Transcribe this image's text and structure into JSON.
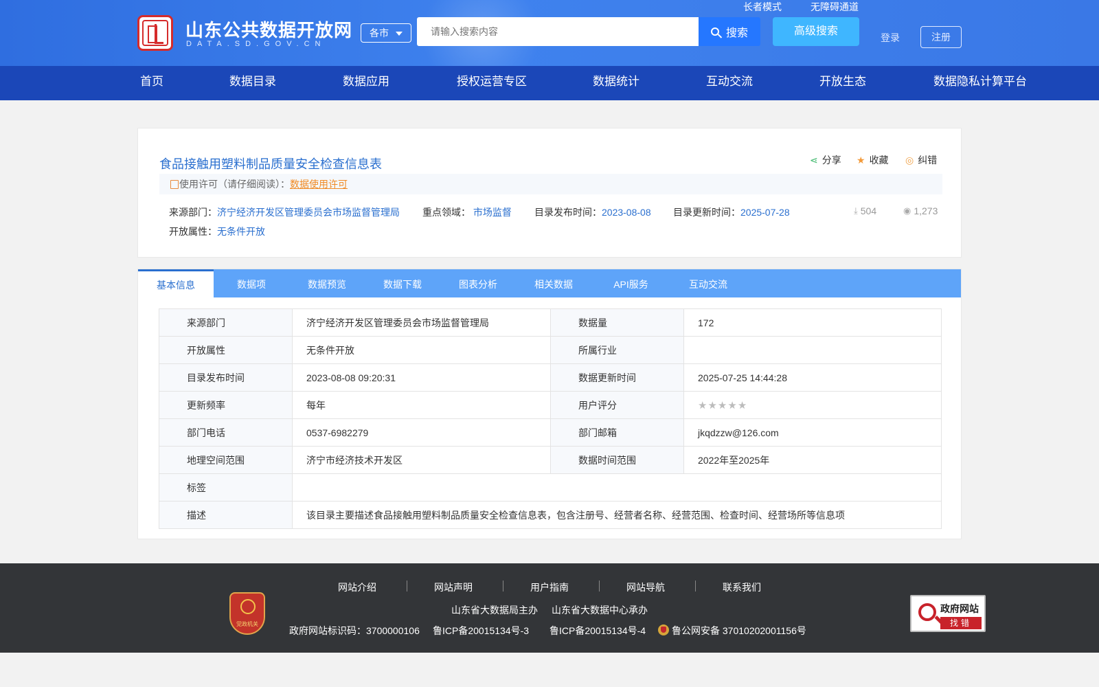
{
  "header": {
    "site_name": "山东公共数据开放网",
    "site_domain": "DATA.SD.GOV.CN",
    "elder_mode": "长者模式",
    "accessibility": "无障碍通道",
    "city_select": "各市",
    "search_placeholder": "请输入搜索内容",
    "search_label": "搜索",
    "advanced_search": "高级搜索",
    "login": "登录",
    "register": "注册"
  },
  "nav": [
    "首页",
    "数据目录",
    "数据应用",
    "授权运营专区",
    "数据统计",
    "互动交流",
    "开放生态",
    "数据隐私计算平台"
  ],
  "dataset": {
    "title": "食品接触用塑料制品质量安全检查信息表",
    "actions": {
      "share": "分享",
      "favorite": "收藏",
      "report": "纠错"
    },
    "license_prefix": "使用许可（请仔细阅读）：",
    "license_link": "数据使用许可",
    "source_label": "来源部门：",
    "source": "济宁经济开发区管理委员会市场监督管理局",
    "field_label": "重点领域：",
    "field": "市场监督",
    "publish_label": "目录发布时间：",
    "publish": "2023-08-08",
    "update_label": "目录更新时间：",
    "update": "2025-07-28",
    "open_label": "开放属性：",
    "open": "无条件开放",
    "downloads": "504",
    "views": "1,273"
  },
  "tabs": [
    "基本信息",
    "数据项",
    "数据预览",
    "数据下载",
    "图表分析",
    "相关数据",
    "API服务",
    "互动交流"
  ],
  "info_table": {
    "rows": [
      {
        "l1": "来源部门",
        "v1": "济宁经济开发区管理委员会市场监督管理局",
        "l2": "数据量",
        "v2": "172"
      },
      {
        "l1": "开放属性",
        "v1": "无条件开放",
        "l2": "所属行业",
        "v2": ""
      },
      {
        "l1": "目录发布时间",
        "v1": "2023-08-08 09:20:31",
        "l2": "数据更新时间",
        "v2": "2025-07-25 14:44:28"
      },
      {
        "l1": "更新频率",
        "v1": "每年",
        "l2": "用户评分",
        "v2": ""
      },
      {
        "l1": "部门电话",
        "v1": "0537-6982279",
        "l2": "部门邮箱",
        "v2": "jkqdzzw@126.com"
      },
      {
        "l1": "地理空间范围",
        "v1": "济宁市经济技术开发区",
        "l2": "数据时间范围",
        "v2": "2022年至2025年"
      }
    ],
    "tag_label": "标签",
    "tag_value": "",
    "desc_label": "描述",
    "desc_value": "该目录主要描述食品接触用塑料制品质量安全检查信息表，包含注册号、经营者名称、经营范围、检查时间、经营场所等信息项",
    "rating": 0
  },
  "footer": {
    "links": [
      "网站介绍",
      "网站声明",
      "用户指南",
      "网站导航",
      "联系我们"
    ],
    "host": "山东省大数据局主办",
    "organizer": "山东省大数据中心承办",
    "site_code": "政府网站标识码：3700000106",
    "icp1": "鲁ICP备20015134号-3",
    "icp2": "鲁ICP备20015134号-4",
    "police": "鲁公网安备 37010202001156号",
    "party_badge": "党政机关",
    "gov_badge_title": "政府网站",
    "gov_badge_action": "找错"
  },
  "colors": {
    "nav_bg": "#1b47b8",
    "tab_bg": "#5ea4f9",
    "link": "#2a6fcf",
    "license_link": "#f08a24"
  }
}
